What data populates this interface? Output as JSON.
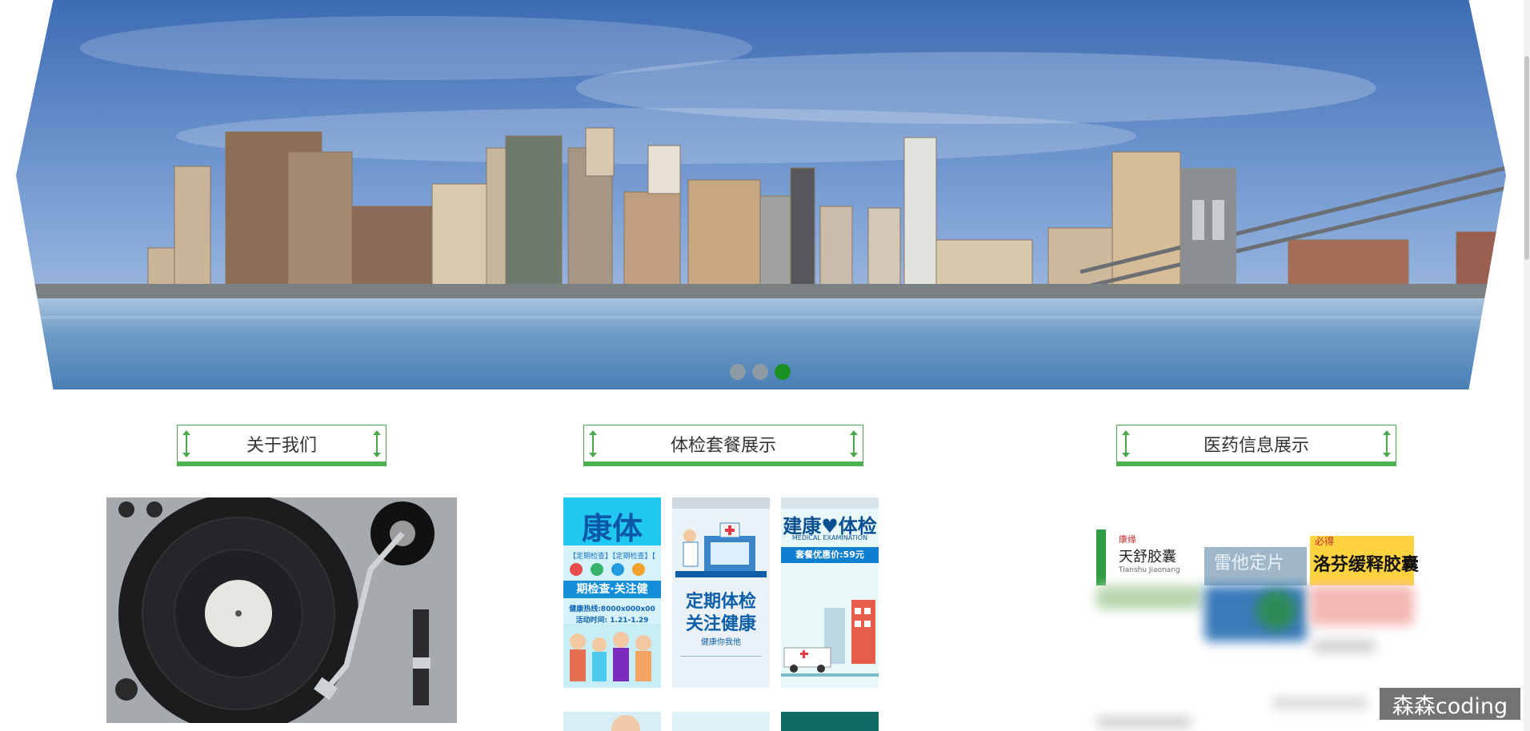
{
  "carousel": {
    "slide_count": 3,
    "active_index": 2
  },
  "sections": {
    "about": {
      "title": "关于我们"
    },
    "packages": {
      "title": "体检套餐展示",
      "posters": [
        {
          "headline": "康体",
          "line1": "期检查·关注健",
          "tags": "【定期检查】【定期检查】【",
          "line2": "健康热线:8000x000x00",
          "line3": "活动时间: 1.21-1.29"
        },
        {
          "headline": "定期体检",
          "line2": "关注健康",
          "small": "健康你我他"
        },
        {
          "headline": "建康♥体检",
          "sub": "MEDICAL EXAMINATION",
          "price": "套餐优惠价:59元"
        }
      ]
    },
    "medicine": {
      "title": "医药信息展示",
      "products": [
        {
          "name": "天舒胶囊",
          "brand": "康缘",
          "sub": "Tianshu Jiaonang"
        },
        {
          "name": "雷他定片",
          "sub": ""
        },
        {
          "name": "洛芬缓释胶囊",
          "brand": "必得"
        }
      ]
    }
  },
  "watermark": "森森coding",
  "colors": {
    "accent_green": "#4caf50",
    "dot_active": "#1a8f22",
    "dot_inactive": "#8c9aa6",
    "sky": "#4f7fc2",
    "water": "#6f9fc6"
  }
}
